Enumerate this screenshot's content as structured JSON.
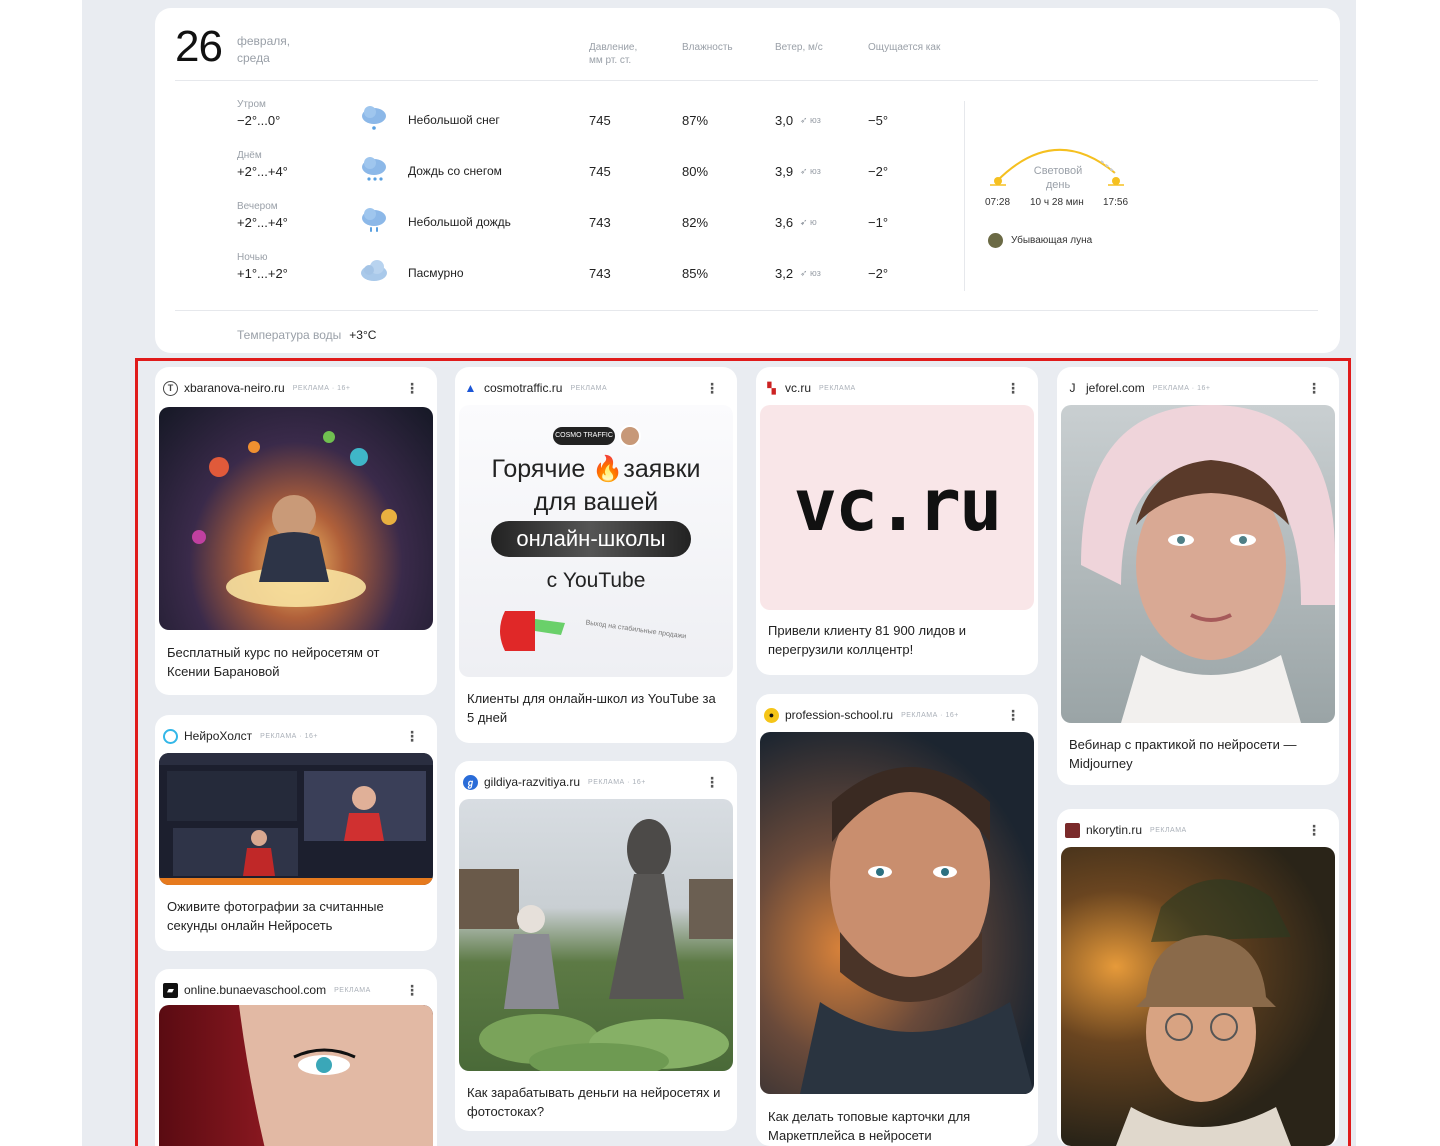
{
  "weather": {
    "day": "26",
    "month_weekday": "февраля, среда",
    "columns": {
      "pressure": "Давление, мм рт. ст.",
      "humidity": "Влажность",
      "wind": "Ветер, м/с",
      "feels": "Ощущается как"
    },
    "rows": [
      {
        "period": "Утром",
        "temp": "−2°...0°",
        "icon": "light-snow-icon",
        "condition": "Небольшой снег",
        "pressure": "745",
        "humidity": "87%",
        "wind": "3,0",
        "wind_dir": "➶ юз",
        "feels": "−5°"
      },
      {
        "period": "Днём",
        "temp": "+2°...+4°",
        "icon": "sleet-icon",
        "condition": "Дождь со снегом",
        "pressure": "745",
        "humidity": "80%",
        "wind": "3,9",
        "wind_dir": "➶ юз",
        "feels": "−2°"
      },
      {
        "period": "Вечером",
        "temp": "+2°...+4°",
        "icon": "light-rain-icon",
        "condition": "Небольшой дождь",
        "pressure": "743",
        "humidity": "82%",
        "wind": "3,6",
        "wind_dir": "➹ ю",
        "feels": "−1°"
      },
      {
        "period": "Ночью",
        "temp": "+1°...+2°",
        "icon": "overcast-icon",
        "condition": "Пасмурно",
        "pressure": "743",
        "humidity": "85%",
        "wind": "3,2",
        "wind_dir": "➶ юз",
        "feels": "−2°"
      }
    ],
    "daylight": {
      "label": "Световой день",
      "sunrise": "07:28",
      "duration": "10 ч 28 мин",
      "sunset": "17:56"
    },
    "moon": "Убывающая луна",
    "water": {
      "label": "Температура воды",
      "value": "+3°C"
    }
  },
  "ad_label": "РЕКЛАМА",
  "ad_label_16": "РЕКЛАМА · 16+",
  "menu_glyph": "⋮",
  "cards": {
    "c1": {
      "domain": "xbaranova-neiro.ru",
      "text": "Бесплатный курс по нейросетям от Ксении Барановой"
    },
    "c2": {
      "domain": "НейроХолст",
      "text": "Оживите фотографии за считанные секунды онлайн Нейросеть"
    },
    "c3": {
      "domain": "online.bunaevaschool.com"
    },
    "c4": {
      "domain": "cosmotraffic.ru",
      "text": "Клиенты для онлайн-школ из YouTube за 5 дней",
      "banner": {
        "logo": "COSMO TRAFFIC",
        "line1a": "Горячие",
        "line1b": "заявки",
        "line2": "для вашей",
        "pill": "онлайн-школы",
        "line3": "с YouTube",
        "note": "Выход на стабильные продажи"
      }
    },
    "c5": {
      "domain": "gildiya-razvitiya.ru",
      "text": "Как зарабатывать деньги на нейросетях и фотостоках?"
    },
    "c6": {
      "domain": "vc.ru",
      "text": "Привели клиенту 81 900 лидов и перегрузили коллцентр!",
      "banner": {
        "logo": "vc.ru"
      }
    },
    "c7": {
      "domain": "profession-school.ru",
      "text": "Как делать топовые карточки для Маркетплейса в нейросети"
    },
    "c8": {
      "domain": "jeforel.com",
      "text": "Вебинар с практикой по нейросети — Midjourney"
    },
    "c9": {
      "domain": "nkorytin.ru"
    }
  }
}
